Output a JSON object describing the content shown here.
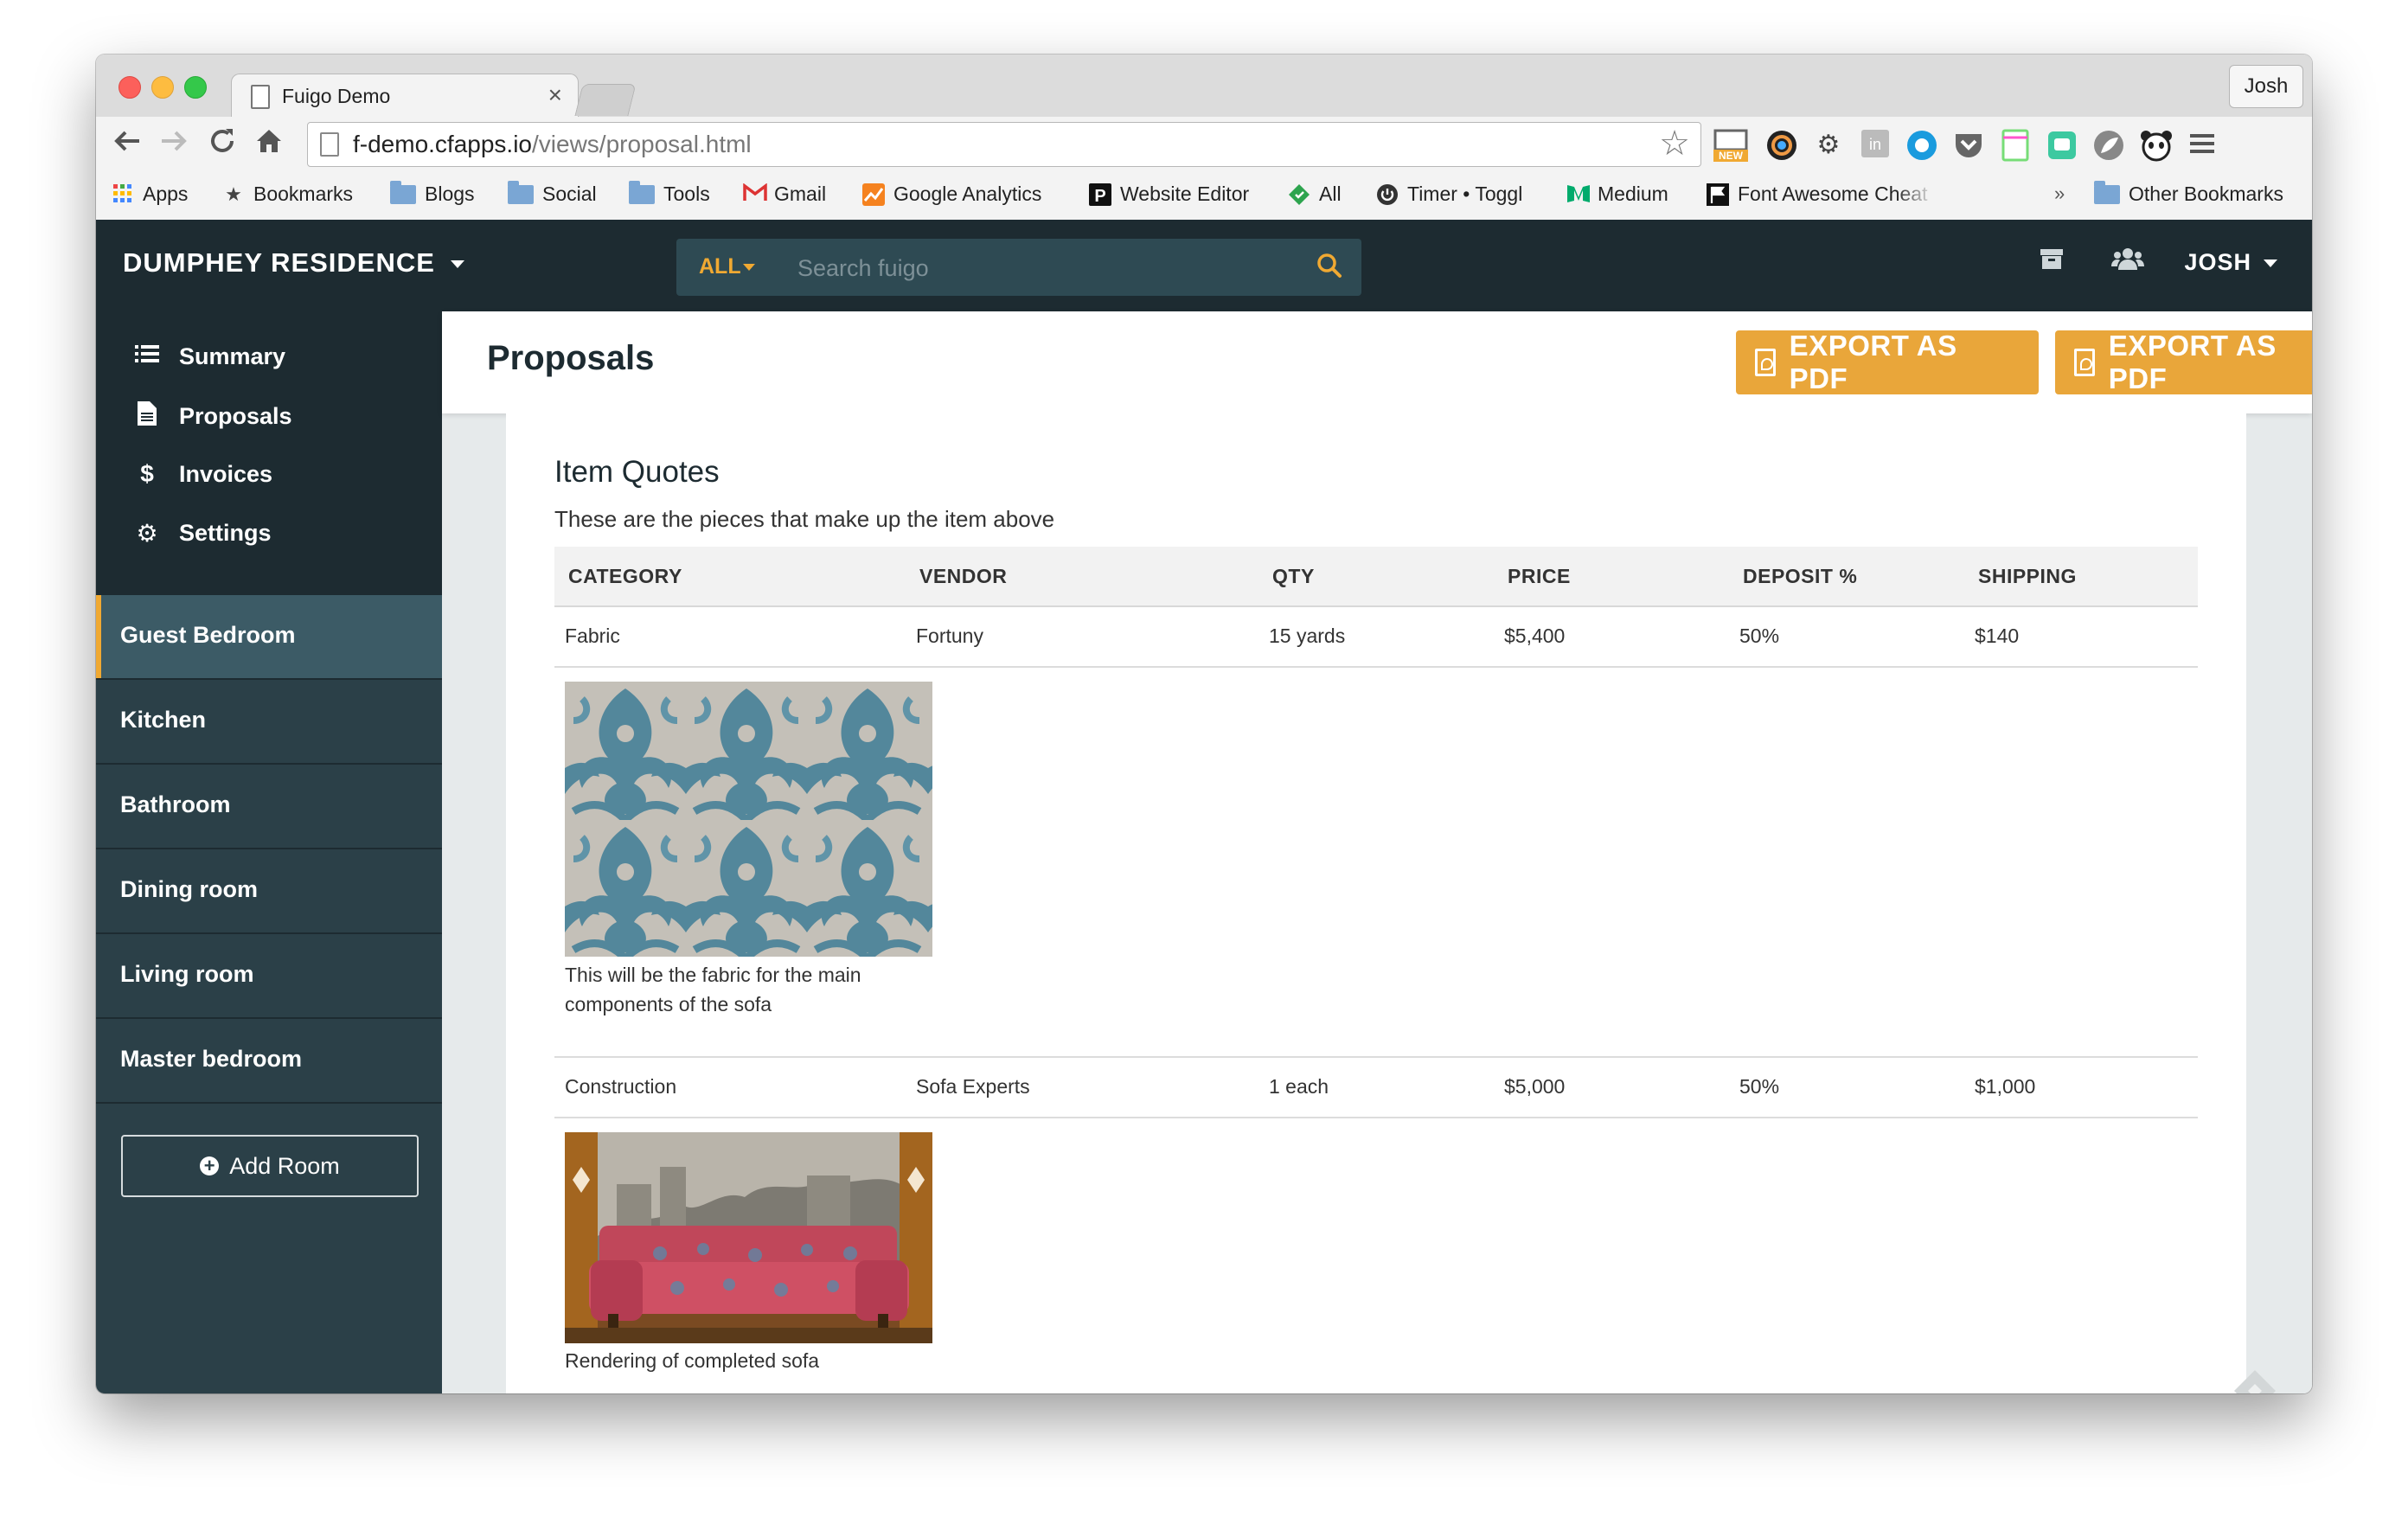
{
  "browser": {
    "tab_title": "Fuigo Demo",
    "tab_close": "×",
    "profile": "Josh",
    "url_host": "f-demo.cfapps.io",
    "url_path": "/views/proposal.html",
    "extension_new_badge": "NEW",
    "bookmarks": [
      {
        "label": "Apps",
        "icon": "apps-grid-icon"
      },
      {
        "label": "Bookmarks",
        "icon": "star-icon"
      },
      {
        "label": "Blogs",
        "icon": "folder-icon"
      },
      {
        "label": "Social",
        "icon": "folder-icon"
      },
      {
        "label": "Tools",
        "icon": "folder-icon"
      },
      {
        "label": "Gmail",
        "icon": "gmail-icon"
      },
      {
        "label": "Google Analytics",
        "icon": "analytics-icon"
      },
      {
        "label": "Website Editor",
        "icon": "p-logo-icon"
      },
      {
        "label": "All",
        "icon": "tag-icon"
      },
      {
        "label": "Timer • Toggl",
        "icon": "power-icon"
      },
      {
        "label": "Medium",
        "icon": "medium-icon"
      },
      {
        "label": "Font Awesome Cheat",
        "icon": "flag-icon"
      }
    ],
    "bookmarks_overflow": "»",
    "other_bookmarks": "Other Bookmarks"
  },
  "app": {
    "project_name": "DUMPHEY RESIDENCE",
    "search": {
      "filter": "ALL",
      "placeholder": "Search fuigo"
    },
    "user": "JOSH",
    "nav": [
      {
        "label": "Summary",
        "icon": "list-icon"
      },
      {
        "label": "Proposals",
        "icon": "document-icon"
      },
      {
        "label": "Invoices",
        "icon": "dollar-icon"
      },
      {
        "label": "Settings",
        "icon": "gear-icon"
      }
    ],
    "rooms": [
      "Guest Bedroom",
      "Kitchen",
      "Bathroom",
      "Dining room",
      "Living room",
      "Master bedroom"
    ],
    "active_room": "Guest Bedroom",
    "add_room": "Add Room",
    "colors": {
      "accent": "#e9a63a",
      "navbar": "#1d2b31",
      "sidebar": "#2b4048",
      "active_room": "#3c5b66"
    }
  },
  "page": {
    "title": "Proposals",
    "export_buttons": [
      "EXPORT AS PDF",
      "EXPORT AS PDF"
    ],
    "section_title": "Item Quotes",
    "section_subtitle": "These are the pieces that make up the item above",
    "columns": [
      "CATEGORY",
      "VENDOR",
      "QTY",
      "PRICE",
      "DEPOSIT %",
      "SHIPPING"
    ],
    "rows": [
      {
        "category": "Fabric",
        "vendor": "Fortuny",
        "qty": "15 yards",
        "price": "$5,400",
        "deposit": "50%",
        "shipping": "$140",
        "caption": "This will be the fabric for the main components of the sofa"
      },
      {
        "category": "Construction",
        "vendor": "Sofa Experts",
        "qty": "1 each",
        "price": "$5,000",
        "deposit": "50%",
        "shipping": "$1,000",
        "caption": "Rendering of completed sofa"
      }
    ]
  }
}
